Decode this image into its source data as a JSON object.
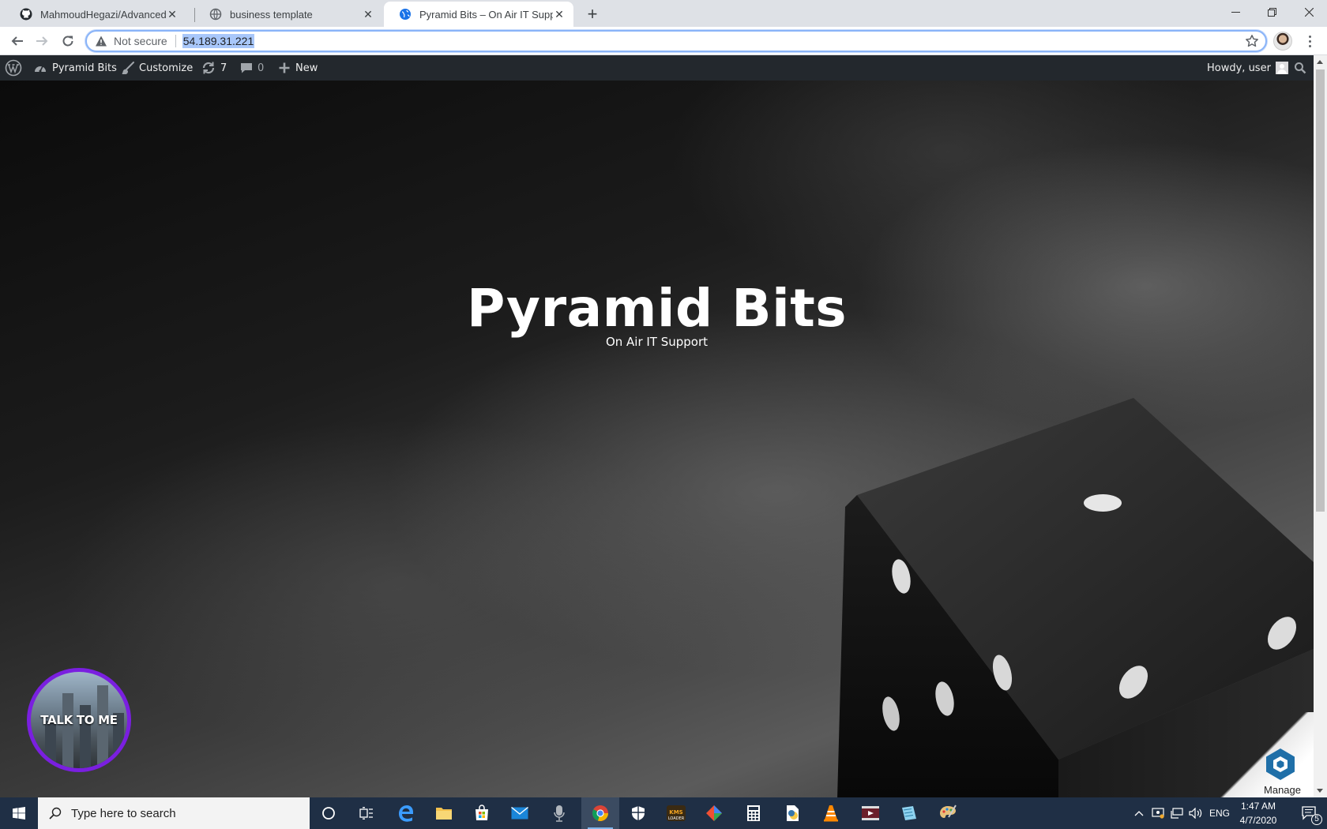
{
  "browser": {
    "tabs": [
      {
        "title": "MahmoudHegazi/Advanced_boo",
        "favicon": "github-icon",
        "active": false
      },
      {
        "title": "business template",
        "favicon": "globe-icon",
        "active": false
      },
      {
        "title": "Pyramid Bits – On Air IT Support",
        "favicon": "globe-icon",
        "active": true
      }
    ],
    "new_tab_label": "+",
    "address": {
      "security_label": "Not secure",
      "url": "54.189.31.221"
    }
  },
  "admin_bar": {
    "site_name": "Pyramid Bits",
    "customize_label": "Customize",
    "updates_count": "7",
    "comments_count": "0",
    "new_label": "New",
    "greeting": "Howdy, user"
  },
  "hero": {
    "title": "Pyramid Bits",
    "tagline": "On Air IT Support"
  },
  "widgets": {
    "talk_label": "TALK TO ME",
    "manage_label": "Manage"
  },
  "taskbar": {
    "search_placeholder": "Type here to search",
    "language": "ENG",
    "time": "1:47 AM",
    "date": "4/7/2020",
    "notification_count": "5"
  },
  "colors": {
    "admin_bar": "#23282d",
    "taskbar": "#1f2f45",
    "talk_border": "#7a1fe0",
    "omnibox_focus": "#8ab4f8"
  }
}
